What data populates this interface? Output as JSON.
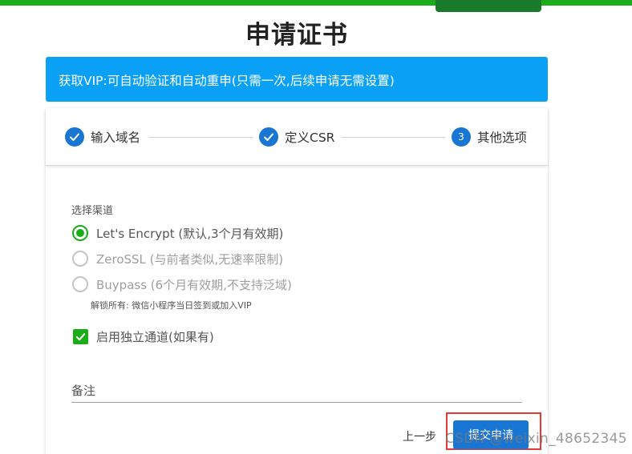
{
  "page": {
    "title": "申请证书"
  },
  "banner": {
    "text": "获取VIP:可自动验证和自动重申(只需一次,后续申请无需设置)"
  },
  "stepper": {
    "steps": [
      {
        "label": "输入域名",
        "status": "done"
      },
      {
        "label": "定义CSR",
        "status": "done"
      },
      {
        "label": "其他选项",
        "number": "3",
        "status": "active"
      }
    ]
  },
  "channel": {
    "label": "选择渠道",
    "options": [
      {
        "label": "Let's Encrypt (默认,3个月有效期)",
        "checked": true,
        "disabled": false
      },
      {
        "label": "ZeroSSL (与前者类似,无速率限制)",
        "checked": false,
        "disabled": true
      },
      {
        "label": "Buypass (6个月有效期,不支持泛域)",
        "checked": false,
        "disabled": true
      }
    ],
    "unlock_note": "解锁所有: 微信小程序当日签到或加入VIP"
  },
  "independent_channel": {
    "label": "启用独立通道(如果有)",
    "checked": true
  },
  "remark": {
    "placeholder": "备注",
    "value": ""
  },
  "actions": {
    "prev_label": "上一步",
    "submit_label": "提交申请"
  },
  "watermark": {
    "text": "CSDN @weixin_48652345"
  },
  "colors": {
    "accent_green": "#1aad19",
    "primary_blue": "#1976d2",
    "banner_blue": "#0aa0f5",
    "highlight_red": "#e53935"
  }
}
